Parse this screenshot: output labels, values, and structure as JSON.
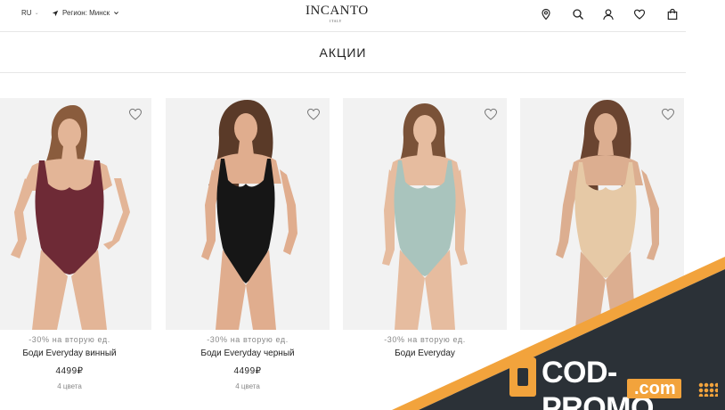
{
  "header": {
    "lang": "RU",
    "region": "Регион: Минск",
    "brand": "INCANTO",
    "brand_sub": "ITALY",
    "icons": [
      "location-icon",
      "search-icon",
      "user-icon",
      "heart-icon",
      "bag-icon"
    ]
  },
  "page": {
    "title": "АКЦИИ"
  },
  "products": [
    {
      "promo": "-30% на вторую ед.",
      "name": "Боди Everyday винный",
      "price": "4499₽",
      "colors": "4 цвета",
      "garment_color": "#6e2a36"
    },
    {
      "promo": "-30% на вторую ед.",
      "name": "Боди Everyday черный",
      "price": "4499₽",
      "colors": "4 цвета",
      "garment_color": "#161616"
    },
    {
      "promo": "-30% на вторую ед.",
      "name": "Боди Everyday",
      "price": "",
      "colors": "",
      "garment_color": "#a9c4bd"
    },
    {
      "promo": "",
      "name": "",
      "price": "",
      "colors": "",
      "garment_color": "#e6c9a6"
    }
  ],
  "banner": {
    "text": "COD-PROMO",
    "domain": ".com",
    "colors": {
      "accent": "#f2a33c",
      "dark": "#2b3137"
    }
  }
}
